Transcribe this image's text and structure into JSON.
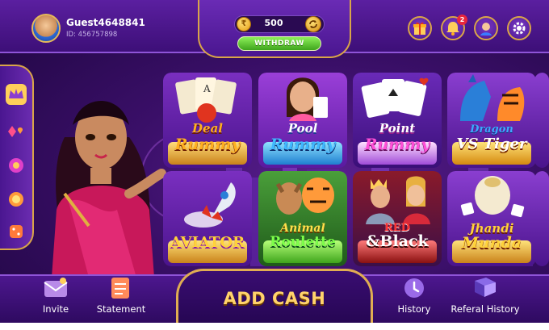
{
  "user": {
    "name": "Guest4648841",
    "id_label": "ID: 456757898"
  },
  "wallet": {
    "coin_symbol": "₹",
    "balance": "500",
    "withdraw_label": "WITHDRAW"
  },
  "header_icons": {
    "gift": "gift-icon",
    "bell": "bell-icon",
    "bell_badge": "2",
    "support": "support-agent-icon",
    "settings": "gear-icon"
  },
  "side_menu": {
    "items": [
      "crown-icon",
      "card-suits-icon",
      "slot-icon",
      "chip-icon",
      "dice-icon"
    ],
    "selected_index": 0
  },
  "games": {
    "row1": [
      {
        "line1": "Deal",
        "line2": "Rummy",
        "color1": "#ffb020",
        "color2": "#ffb020"
      },
      {
        "line1": "Pool",
        "line2": "Rummy",
        "color1": "#ffffff",
        "color2": "#3fb8ff"
      },
      {
        "line1": "Point",
        "line2": "Rummy",
        "color1": "#ffffff",
        "color2": "#ff4fd8"
      },
      {
        "line1": "Dragon",
        "line2": "VS Tiger",
        "color1": "#3fa7ff",
        "color2": "#ffffff"
      }
    ],
    "row2": [
      {
        "line1": "",
        "line2": "AVIATOR",
        "color1": "#ffffff",
        "color2": "#ffd23a"
      },
      {
        "line1": "Animal",
        "line2": "Roulette",
        "color1": "#ffe04a",
        "color2": "#7dff4a"
      },
      {
        "line1": "RED",
        "line2": "&Black",
        "color1": "#ff3030",
        "color2": "#ffffff"
      },
      {
        "line1": "Jhandi",
        "line2": "Munda",
        "color1": "#ffd23a",
        "color2": "#ffd23a"
      }
    ]
  },
  "bottom": {
    "invite": "Invite",
    "statement": "Statement",
    "add_cash": "ADD CASH",
    "history": "History",
    "referral_history": "Referal History"
  },
  "colors": {
    "gold": "#d9a548",
    "purple_dark": "#2e0a60",
    "withdraw_green": "#3fa51c"
  }
}
